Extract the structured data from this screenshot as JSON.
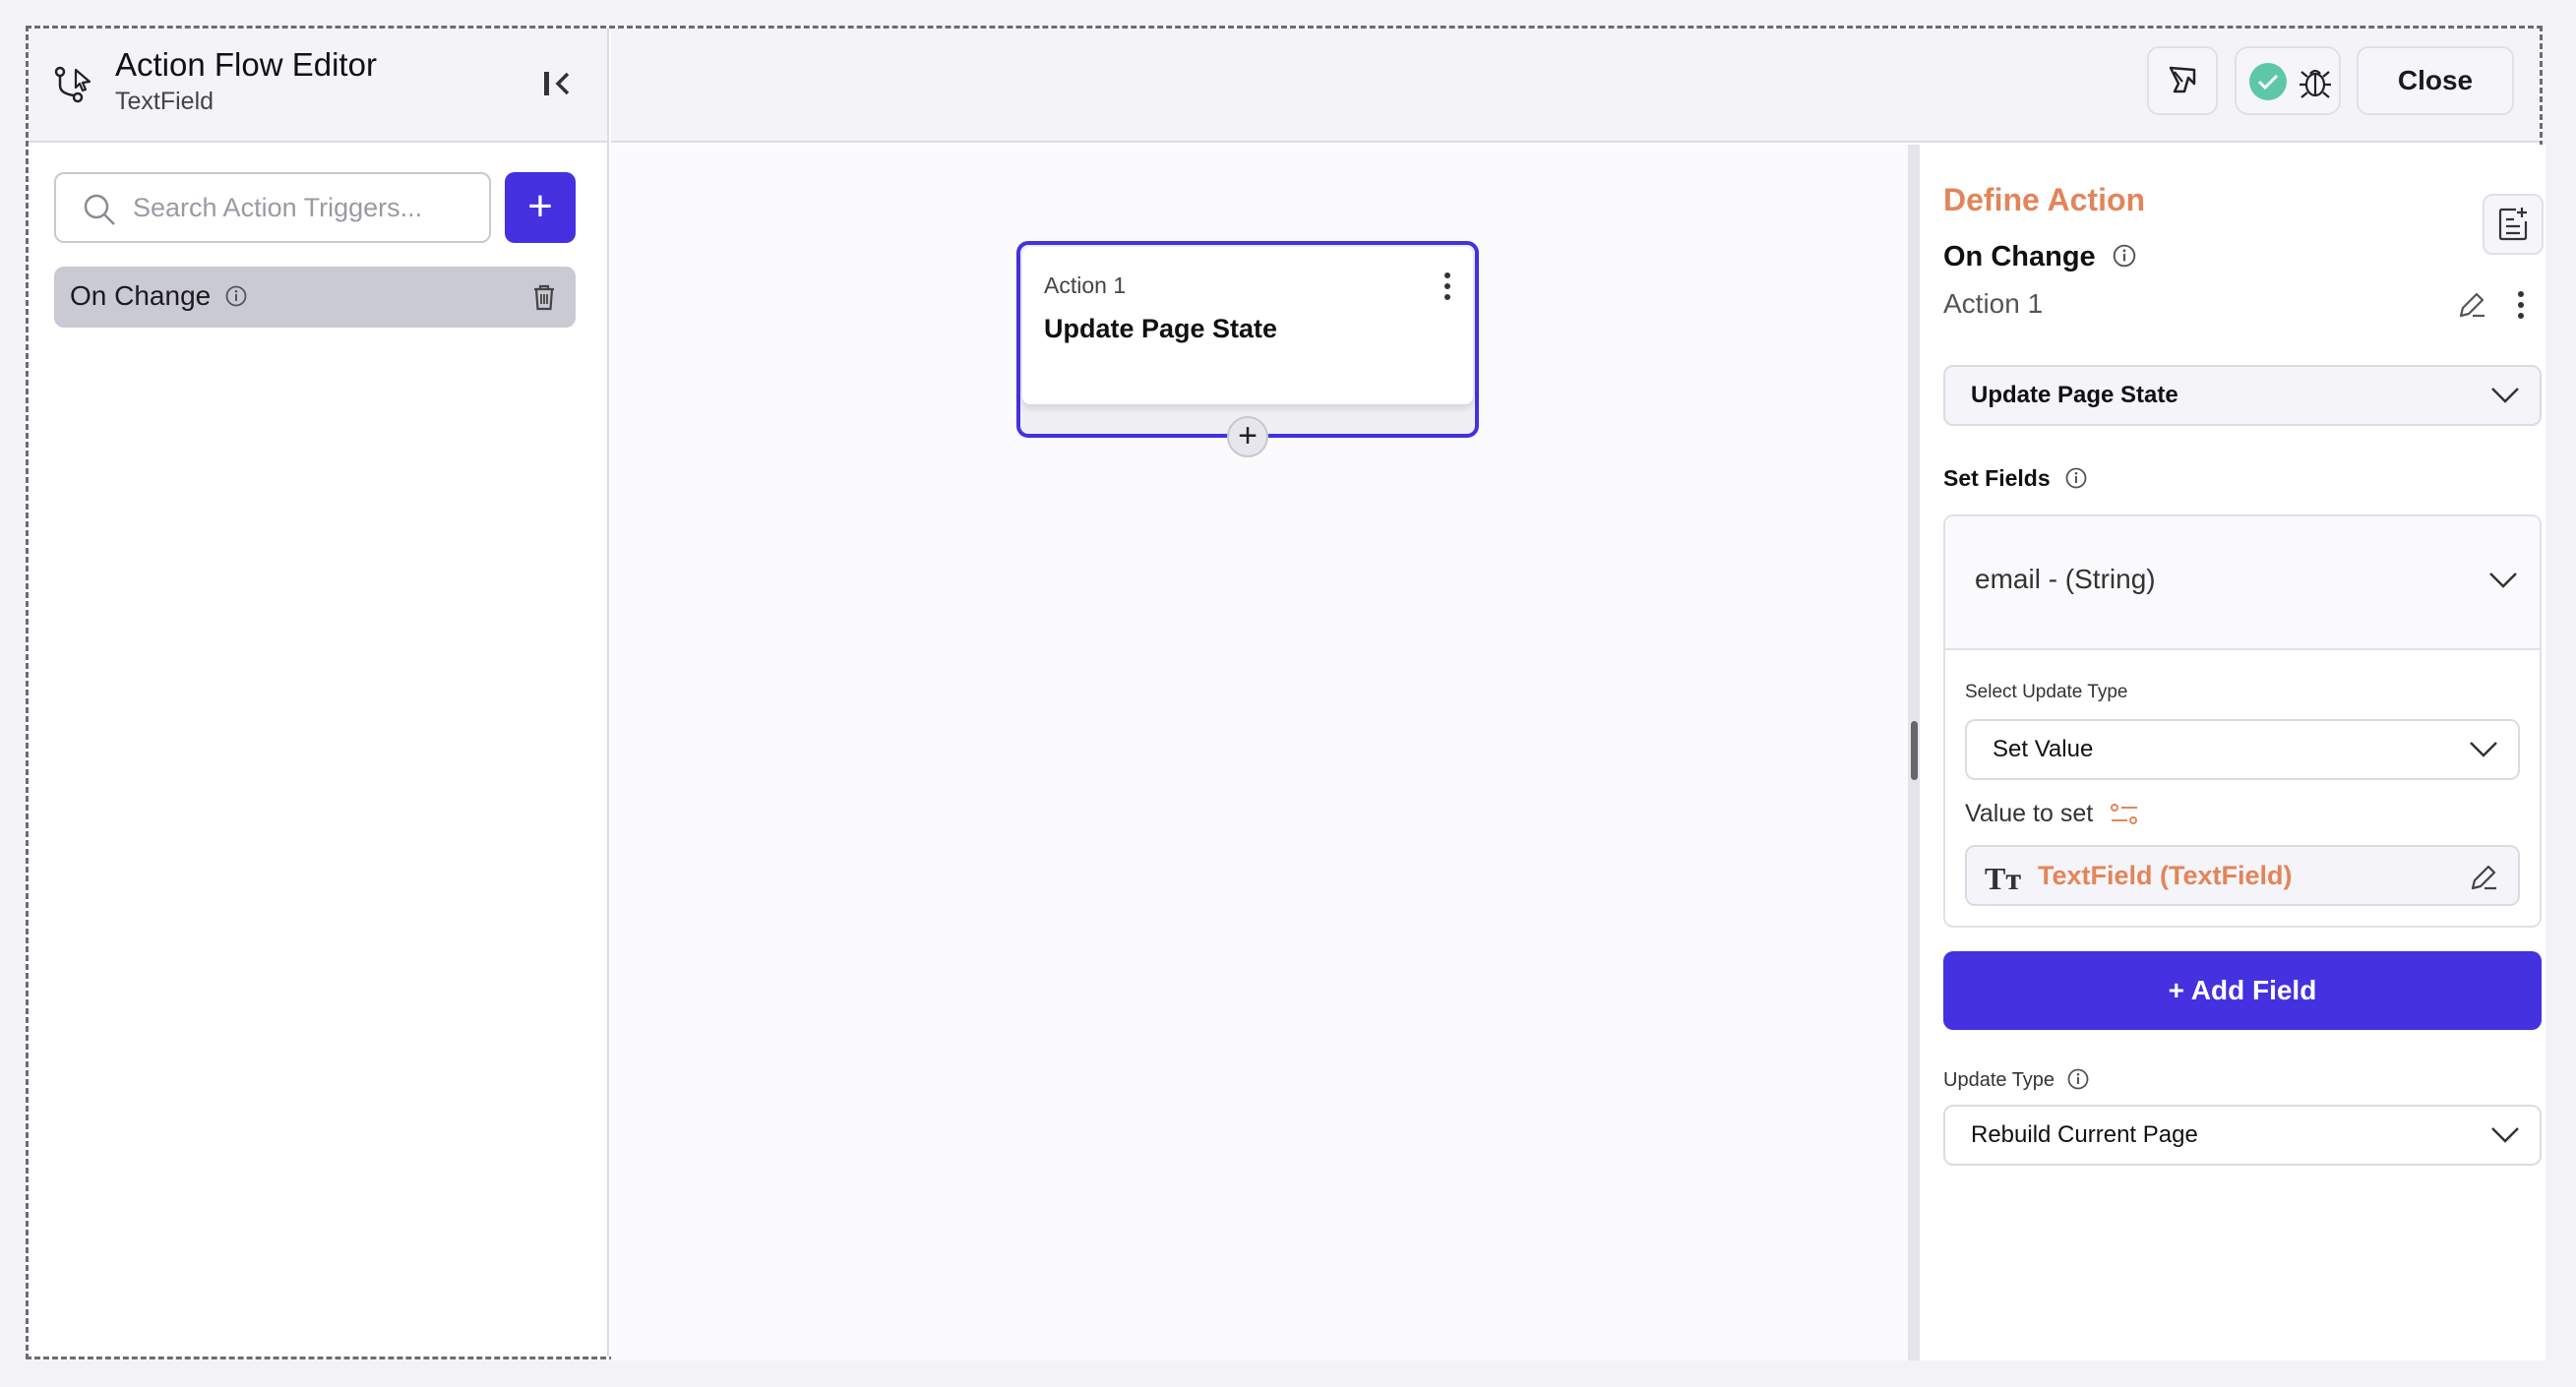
{
  "header": {
    "title": "Action Flow Editor",
    "subtitle": "TextField"
  },
  "search": {
    "placeholder": "Search Action Triggers..."
  },
  "add_trigger_label": "+",
  "triggers": [
    {
      "label": "On Change"
    }
  ],
  "toolbar": {
    "close_label": "Close",
    "status_color": "#5dc7a8"
  },
  "canvas": {
    "node": {
      "small_label": "Action 1",
      "title": "Update Page State"
    },
    "add_node_label": "+"
  },
  "panel": {
    "title": "Define Action",
    "trigger": "On Change",
    "action_name": "Action 1",
    "action_type": "Update Page State",
    "set_fields_label": "Set Fields",
    "field": {
      "name": "email - (String)",
      "update_type_label": "Select Update Type",
      "update_type_value": "Set Value",
      "value_to_set_label": "Value to set",
      "value_icon": "Tт",
      "value": "TextField (TextField)"
    },
    "add_field_label": "+   Add Field",
    "update_type_label": "Update Type",
    "update_type_value": "Rebuild Current Page"
  },
  "colors": {
    "accent": "#4431e0",
    "orange": "#e2855a"
  }
}
